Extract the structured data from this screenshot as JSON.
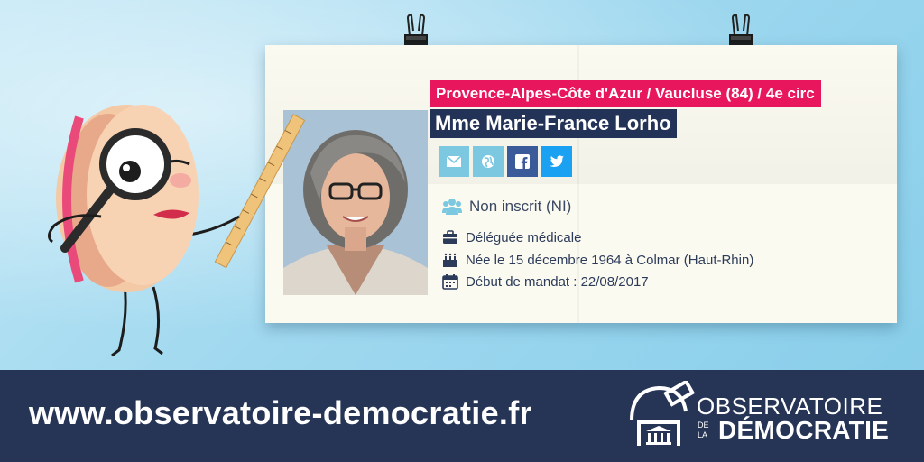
{
  "card": {
    "region": "Provence-Alpes-Côte d'Azur / Vaucluse (84) / 4e circ",
    "name": "Mme Marie-France Lorho",
    "group": "Non inscrit (NI)",
    "profession": "Déléguée médicale",
    "birth": "Née le 15 décembre 1964 à Colmar (Haut-Rhin)",
    "mandate": "Début de mandat : 22/08/2017"
  },
  "social": {
    "icons": [
      "mail-icon",
      "globe-icon",
      "facebook-icon",
      "twitter-icon"
    ]
  },
  "footer": {
    "url": "www.observatoire-democratie.fr",
    "logo_line1": "OBSERVATOIRE",
    "logo_de": "DE",
    "logo_la": "LA",
    "logo_line2": "DÉMOCRATIE"
  },
  "colors": {
    "accent_pink": "#e8175d",
    "navy": "#233358",
    "footer_bg": "#263556",
    "card_bg": "#fbfaf0"
  }
}
